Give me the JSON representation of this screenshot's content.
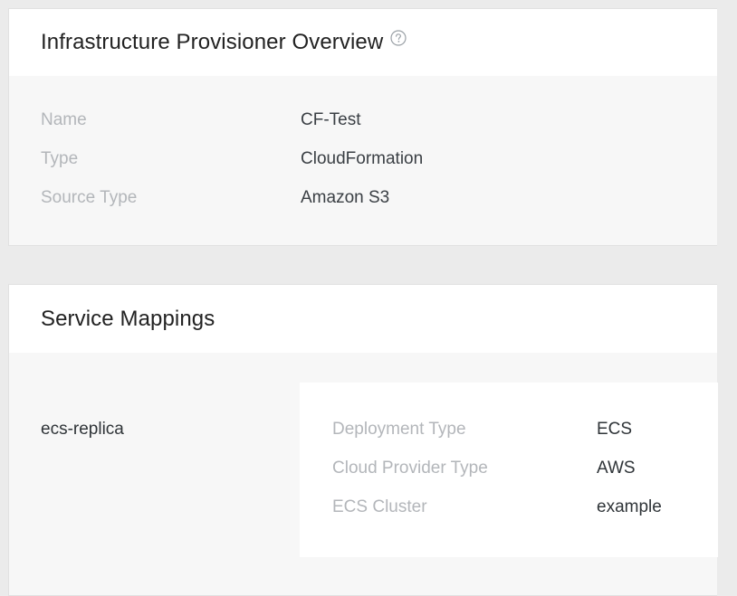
{
  "overview": {
    "title": "Infrastructure Provisioner Overview",
    "help_icon": "help-circle-icon",
    "fields": [
      {
        "label": "Name",
        "value": "CF-Test"
      },
      {
        "label": "Type",
        "value": "CloudFormation"
      },
      {
        "label": "Source Type",
        "value": "Amazon S3"
      }
    ]
  },
  "service_mappings": {
    "title": "Service Mappings",
    "mappings": [
      {
        "name": "ecs-replica",
        "fields": [
          {
            "label": "Deployment Type",
            "value": "ECS"
          },
          {
            "label": "Cloud Provider Type",
            "value": "AWS"
          },
          {
            "label": "ECS Cluster",
            "value": "example"
          }
        ]
      }
    ]
  },
  "colors": {
    "background": "#ebebeb",
    "card_body": "#f7f7f7",
    "card_header": "#ffffff",
    "label": "#b3b6ba",
    "value": "#3a3f44"
  }
}
